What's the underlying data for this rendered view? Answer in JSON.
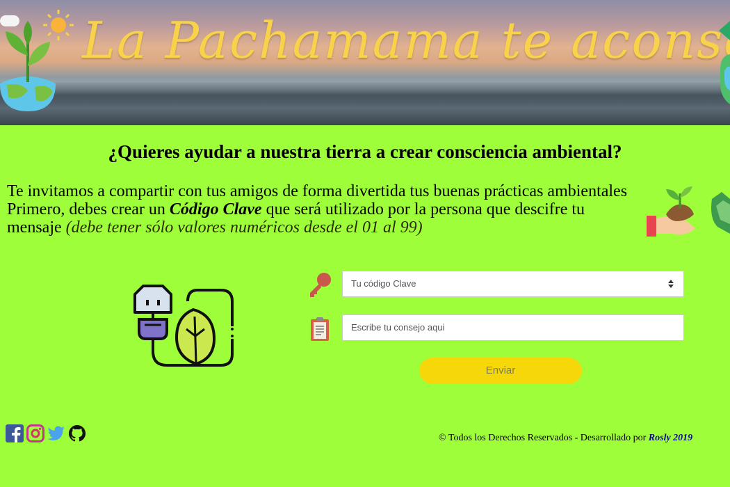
{
  "banner": {
    "title": "La Pachamama te aconseja"
  },
  "heading": "¿Quieres ayudar a nuestra tierra a crear consciencia ambiental?",
  "intro": {
    "part1": "Te invitamos a compartir con tus amigos de forma divertida tus buenas prácticas ambientales Primero, debes crear un ",
    "bold": "Código Clave",
    "part2": " que será utilizado por la persona que descifre tu mensaje ",
    "note": "(debe tener sólo valores numéricos desde el 01 al 99)"
  },
  "form": {
    "code_placeholder": "Tu código Clave",
    "tip_placeholder": "Escribe tu consejo aqui",
    "send_label": "Enviar"
  },
  "socials": [
    "facebook-icon",
    "instagram-icon",
    "twitter-icon",
    "github-icon"
  ],
  "footer": {
    "text": "© Todos los Derechos Reservados - Desarrollado por ",
    "author": "Rosly 2019"
  },
  "colors": {
    "background": "#9ffe3a",
    "title": "#f7d24a",
    "button": "#f6d70a"
  }
}
